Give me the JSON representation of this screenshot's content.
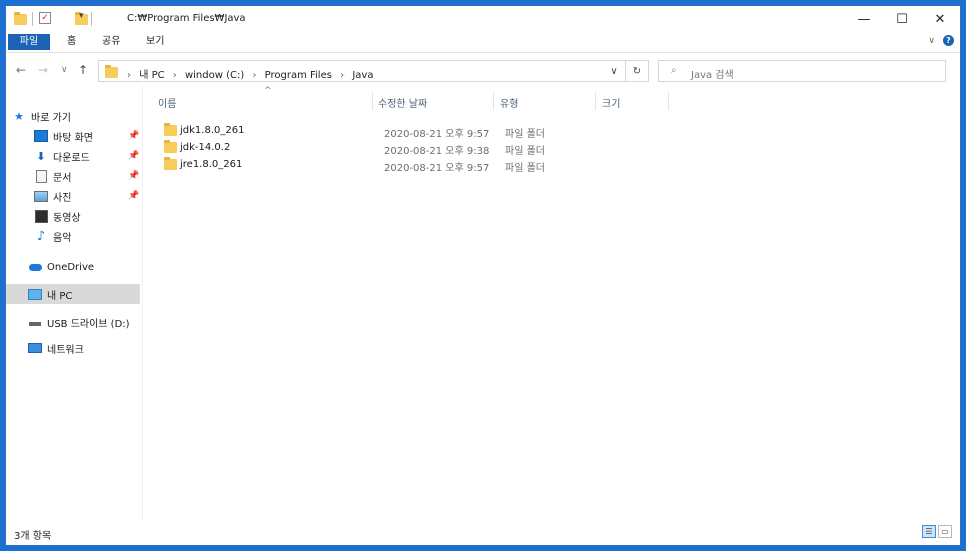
{
  "title_bar": {
    "path_title": "C:₩Program Files₩Java",
    "minimize": "—",
    "maximize": "☐",
    "close": "✕",
    "quick_dropdown": "▾"
  },
  "ribbon": {
    "tabs": [
      "파일",
      "홈",
      "공유",
      "보기"
    ],
    "expand": "∨",
    "help": "?"
  },
  "navigation": {
    "back": "←",
    "forward": "→",
    "recent": "∨",
    "up": "↑",
    "breadcrumbs": [
      "내 PC",
      "window (C:)",
      "Program Files",
      "Java"
    ],
    "address_dropdown": "∨",
    "refresh": "↻",
    "search_placeholder": "Java 검색"
  },
  "sidebar": {
    "quick_access": "바로 가기",
    "items": [
      {
        "label": "바탕 화면",
        "icon": "desktop-icon",
        "pinned": true
      },
      {
        "label": "다운로드",
        "icon": "download-icon",
        "pinned": true
      },
      {
        "label": "문서",
        "icon": "document-icon",
        "pinned": true
      },
      {
        "label": "사진",
        "icon": "pictures-icon",
        "pinned": true
      },
      {
        "label": "동영상",
        "icon": "video-icon",
        "pinned": false
      },
      {
        "label": "음악",
        "icon": "music-icon",
        "pinned": false
      }
    ],
    "onedrive": "OneDrive",
    "this_pc": "내 PC",
    "usb": "USB 드라이브 (D:)",
    "network": "네트워크"
  },
  "columns": {
    "name": "이름",
    "date": "수정한 날짜",
    "type": "유형",
    "size": "크기"
  },
  "files": [
    {
      "name": "jdk1.8.0_261",
      "date": "2020-08-21 오후 9:57",
      "type": "파일 폴더"
    },
    {
      "name": "jdk-14.0.2",
      "date": "2020-08-21 오후 9:38",
      "type": "파일 폴더"
    },
    {
      "name": "jre1.8.0_261",
      "date": "2020-08-21 오후 9:57",
      "type": "파일 폴더"
    }
  ],
  "status": {
    "item_count": "3개 항목"
  },
  "colors": {
    "accent": "#1c63b5",
    "folder": "#f6cd5b",
    "desktop_bg": "#1d6fd0"
  }
}
